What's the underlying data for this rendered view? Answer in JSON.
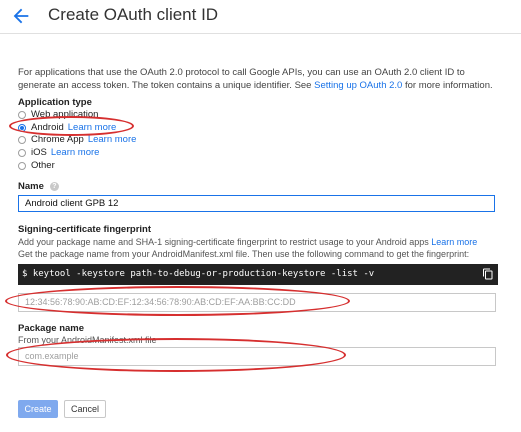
{
  "header": {
    "title": "Create OAuth client ID"
  },
  "intro": {
    "text": "For applications that use the OAuth 2.0 protocol to call Google APIs, you can use an OAuth 2.0 client ID to generate an access token. The token contains a unique identifier. See ",
    "link": "Setting up OAuth 2.0",
    "suffix": " for more information."
  },
  "app_type": {
    "label": "Application type",
    "options": [
      {
        "label": "Web application",
        "link": ""
      },
      {
        "label": "Android",
        "link": "Learn more"
      },
      {
        "label": "Chrome App",
        "link": "Learn more"
      },
      {
        "label": "iOS",
        "link": "Learn more"
      },
      {
        "label": "Other",
        "link": ""
      }
    ],
    "selected": "Android"
  },
  "name": {
    "label": "Name",
    "value": "Android client GPB 12"
  },
  "signing": {
    "label": "Signing-certificate fingerprint",
    "desc1": "Add your package name and SHA-1 signing-certificate fingerprint to restrict usage to your Android apps ",
    "desc1_link": "Learn more",
    "desc2": "Get the package name from your AndroidManifest.xml file. Then use the following command to get the fingerprint:",
    "command": "$ keytool -keystore path-to-debug-or-production-keystore -list -v",
    "placeholder": "12:34:56:78:90:AB:CD:EF:12:34:56:78:90:AB:CD:EF:AA:BB:CC:DD"
  },
  "package": {
    "label": "Package name",
    "desc": "From your AndroidManifest.xml file",
    "placeholder": "com.example"
  },
  "buttons": {
    "create": "Create",
    "cancel": "Cancel"
  },
  "colors": {
    "accent": "#1a73e8",
    "annotation": "#d62f2f",
    "code_bg": "#222222"
  }
}
